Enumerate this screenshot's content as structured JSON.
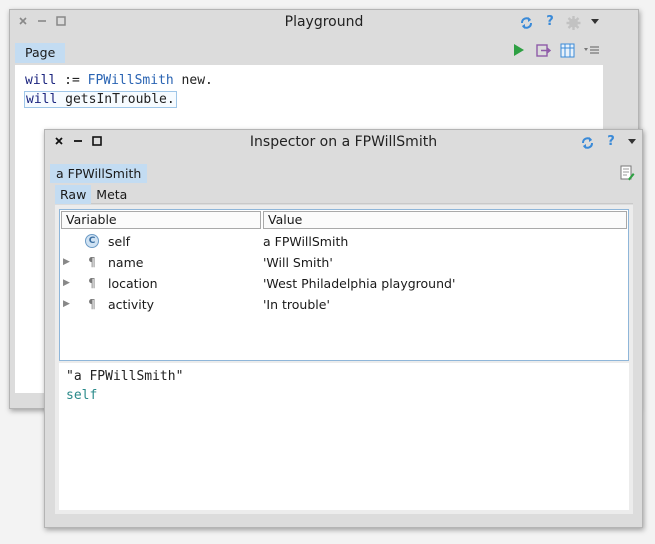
{
  "playground": {
    "title": "Playground",
    "tab_label": "Page",
    "code": {
      "line1": {
        "var": "will",
        "assign": " := ",
        "cls": "FPWillSmith",
        "msg": " new."
      },
      "line2": {
        "var": "will",
        "msg": " getsInTrouble."
      }
    },
    "colors": {
      "run": "#2ea043",
      "accent": "#3a8ad8"
    }
  },
  "inspector": {
    "title": "Inspector on a FPWillSmith",
    "tab_label": "a FPWillSmith",
    "subtabs": [
      "Raw",
      "Meta"
    ],
    "table": {
      "headers": {
        "variable": "Variable",
        "value": "Value"
      },
      "rows": [
        {
          "icon": "c",
          "name": "self",
          "value": "a FPWillSmith"
        },
        {
          "icon": "¶",
          "name": "name",
          "value": "'Will Smith'"
        },
        {
          "icon": "¶",
          "name": "location",
          "value": "'West Philadelphia playground'"
        },
        {
          "icon": "¶",
          "name": "activity",
          "value": "'In trouble'"
        }
      ]
    },
    "eval": {
      "line1": "\"a FPWillSmith\"",
      "line2": "self"
    }
  }
}
